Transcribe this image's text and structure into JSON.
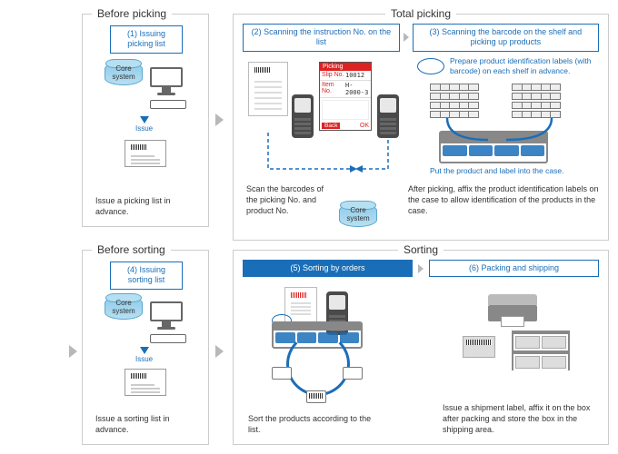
{
  "panels": {
    "before_picking": "Before picking",
    "total_picking": "Total picking",
    "before_sorting": "Before sorting",
    "sorting": "Sorting"
  },
  "steps": {
    "s1": "(1) Issuing picking list",
    "s2": "(2) Scanning the instruction No. on the list",
    "s3": "(3) Scanning the barcode on the shelf and picking up products",
    "s4": "(4) Issuing sorting list",
    "s5": "(5) Sorting by orders",
    "s6": "(6) Packing and shipping"
  },
  "labels": {
    "core_system": "Core system",
    "issue": "Issue"
  },
  "captions": {
    "c1": "Issue a picking list in advance.",
    "c2": "Scan the barcodes of the picking No. and product No.",
    "c3a": "Prepare product identification labels (with barcode) on each shelf in advance.",
    "c3b": "Put the product and label into the case.",
    "c3c": "After picking, affix the product identification labels on the case to allow identification of the products in the case.",
    "c4": "Issue a sorting list in advance.",
    "c5": "Sort the products according to the list.",
    "c6": "Issue a shipment label, affix it on the box after packing and store the box in the shipping area."
  },
  "ht_screen": {
    "title": "Picking",
    "row1_k": "Slip No.",
    "row1_v": "10012",
    "row2_k": "Item No.",
    "row2_v": "H-2000-3",
    "back": "Back",
    "ok": "OK"
  }
}
